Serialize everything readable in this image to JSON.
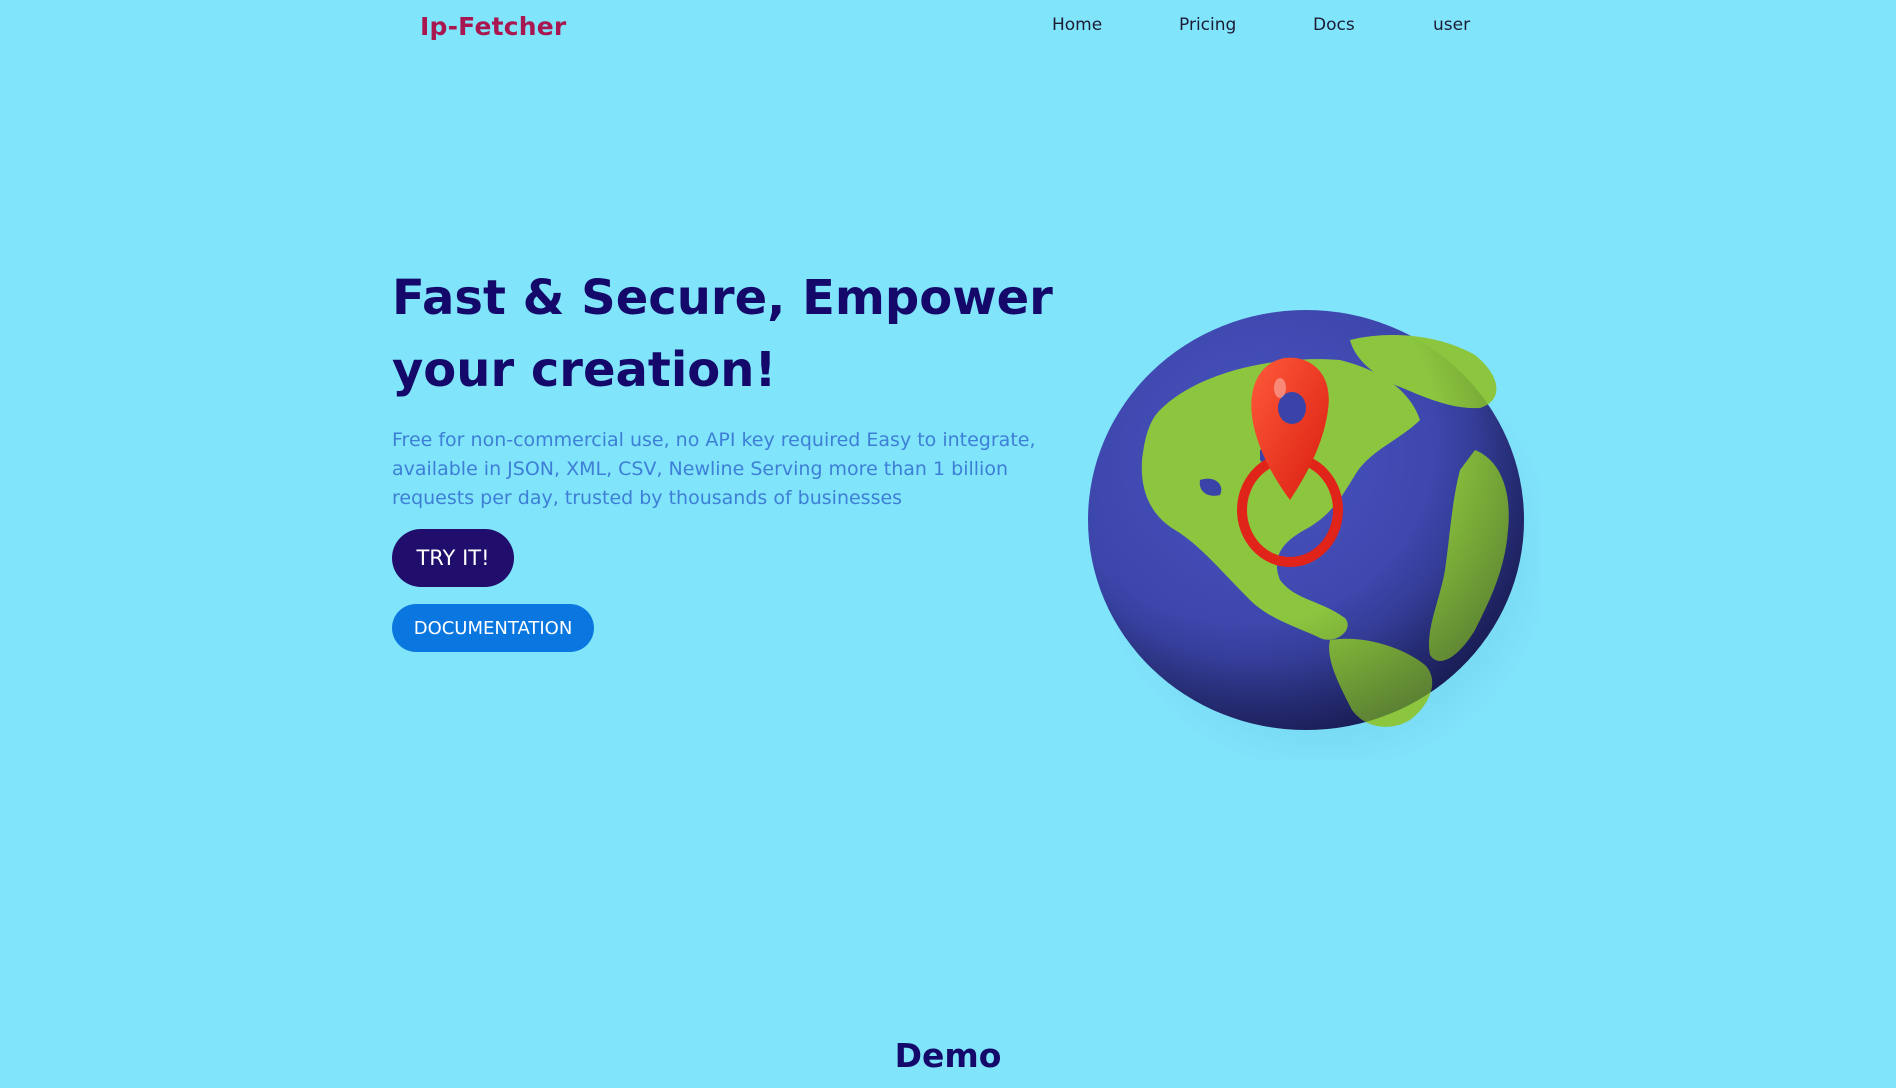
{
  "nav": {
    "brand": "Ip-Fetcher",
    "links": [
      "Home",
      "Pricing",
      "Docs",
      "user"
    ]
  },
  "hero": {
    "title": "Fast & Secure, Empower your creation!",
    "subtitle": "Free for non-commercial use, no API key required Easy to integrate, available in JSON, XML, CSV, Newline Serving more than 1 billion requests per day, trusted by thousands of businesses",
    "try_button": "TRY IT!",
    "docs_button": "DOCUMENTATION",
    "illustration": "globe-with-location-pin"
  },
  "demo": {
    "title": "Demo"
  },
  "colors": {
    "background": "#80e4fb",
    "brand": "#a8174f",
    "heading": "#14096a",
    "subtitle": "#3d7fd6",
    "try_button": "#210d6c",
    "docs_button": "#0a77e0"
  }
}
